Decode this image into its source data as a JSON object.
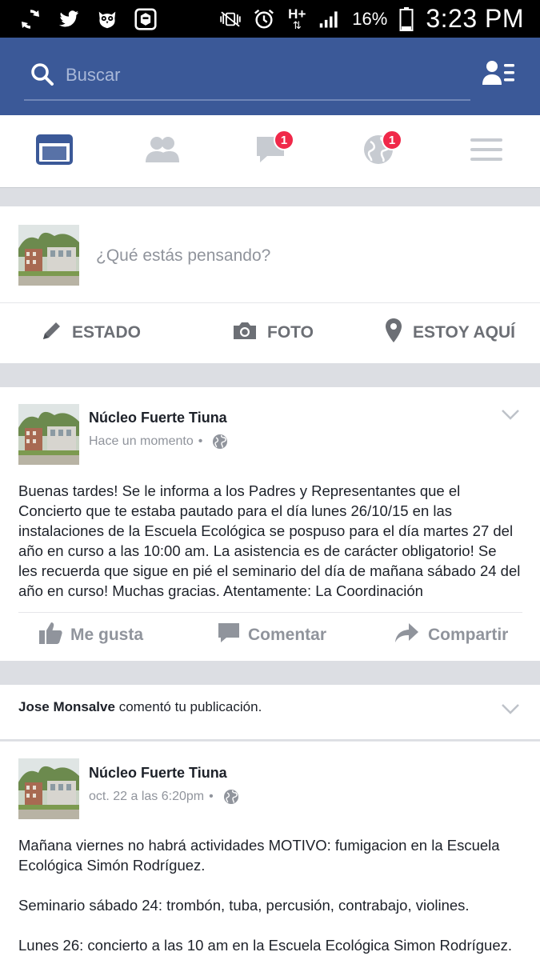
{
  "status_bar": {
    "battery": "16%",
    "time": "3:23 PM",
    "network": "H+"
  },
  "search": {
    "placeholder": "Buscar"
  },
  "tabs": [
    {
      "name": "news-feed",
      "badge": ""
    },
    {
      "name": "friend-requests",
      "badge": ""
    },
    {
      "name": "messages",
      "badge": "1"
    },
    {
      "name": "notifications",
      "badge": "1"
    },
    {
      "name": "more",
      "badge": ""
    }
  ],
  "composer": {
    "prompt": "¿Qué estás pensando?",
    "actions": {
      "status": "ESTADO",
      "photo": "FOTO",
      "checkin": "ESTOY AQUÍ"
    }
  },
  "post1": {
    "author": "Núcleo Fuerte Tiuna",
    "time": "Hace un momento",
    "separator": "•",
    "text": "Buenas tardes! Se le informa a los Padres y Representantes que el\nConcierto que te estaba pautado para el día lunes 26/10/15 en las\ninstalaciones de la Escuela Ecológica se pospuso para el día martes 27 del\naño en curso a las 10:00 am. La asistencia  es de carácter  obligatorio! Se\nles recuerda que sigue en pié  el seminario del día de mañana sábado 24 del\naño en curso! Muchas gracias. Atentamente: La Coordinación",
    "actions": {
      "like": "Me gusta",
      "comment": "Comentar",
      "share": "Compartir"
    }
  },
  "notice": {
    "actor": "Jose Monsalve",
    "text": "comentó tu publicación."
  },
  "post2": {
    "author": "Núcleo Fuerte Tiuna",
    "time": "oct. 22 a las 6:20pm",
    "separator": "•",
    "text": "Mañana viernes no habrá actividades MOTIVO: fumigacion  en la Escuela\nEcológica  Simón Rodríguez.\n\nSeminario sábado 24: trombón, tuba, percusión, contrabajo, violines.\n\nLunes 26: concierto a las 10 am en la Escuela Ecológica Simon Rodríguez."
  },
  "colors": {
    "brand": "#3b5998",
    "badge": "#f02849",
    "active_tab": "#3b5998",
    "inactive_icon": "#c7cbd1"
  }
}
